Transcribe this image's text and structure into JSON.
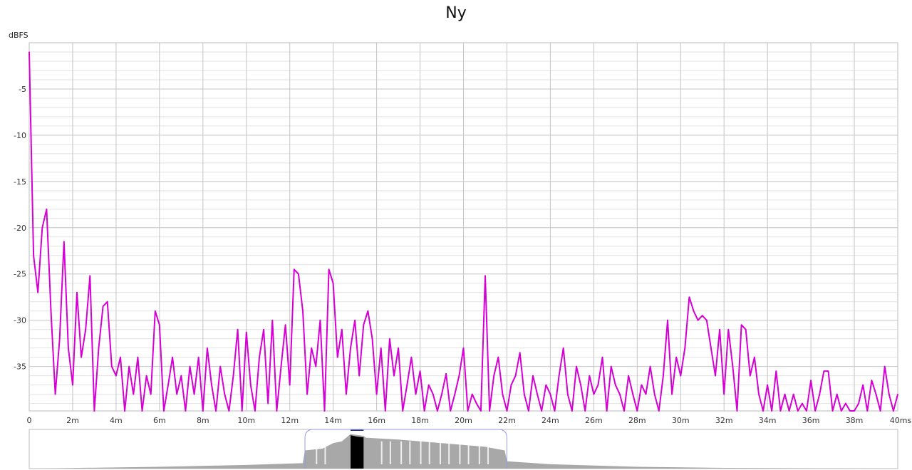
{
  "chart_data": {
    "type": "line",
    "title": "Ny",
    "ylabel": "dBFS",
    "xlabel": "",
    "xlim": [
      0,
      40
    ],
    "ylim": [
      -39.8,
      0
    ],
    "x_unit_suffix": "ms",
    "x_ticks": [
      "0",
      "2m",
      "4m",
      "6m",
      "8m",
      "10m",
      "12m",
      "14m",
      "16m",
      "18m",
      "20m",
      "22m",
      "24m",
      "26m",
      "28m",
      "30m",
      "32m",
      "34m",
      "36m",
      "38m",
      "40ms"
    ],
    "y_ticks": [
      "-5",
      "-10",
      "-15",
      "-20",
      "-25",
      "-30",
      "-35"
    ],
    "grid": true,
    "series": [
      {
        "name": "Ny",
        "color": "#d400d4",
        "x_start": 0,
        "x_step": 0.2,
        "values": [
          -1,
          -23,
          -27,
          -20,
          -18,
          -29,
          -38,
          -32,
          -21.5,
          -33,
          -37,
          -27,
          -34,
          -31,
          -25.2,
          -40,
          -33,
          -28.5,
          -28,
          -35,
          -36,
          -34,
          -40,
          -35,
          -38,
          -34,
          -40,
          -36,
          -38,
          -29,
          -30.5,
          -40,
          -37,
          -34,
          -38,
          -36,
          -40,
          -35,
          -38,
          -34,
          -40,
          -33,
          -37,
          -40,
          -35,
          -38,
          -40,
          -36,
          -31,
          -40,
          -31.3,
          -37,
          -40,
          -34,
          -31,
          -39,
          -30,
          -40,
          -35,
          -30.5,
          -37,
          -24.5,
          -25,
          -29,
          -38,
          -33,
          -35,
          -30,
          -40,
          -24.5,
          -26,
          -34,
          -31,
          -38,
          -33,
          -30,
          -36,
          -30.5,
          -29,
          -32,
          -38,
          -33,
          -40,
          -32,
          -36,
          -33,
          -40,
          -37,
          -34,
          -38,
          -35.5,
          -40,
          -37,
          -38,
          -40,
          -38,
          -35.8,
          -40,
          -38,
          -36,
          -33,
          -40,
          -38,
          -39,
          -40,
          -25.2,
          -40,
          -36,
          -34,
          -38,
          -40,
          -37,
          -36,
          -33.5,
          -38,
          -40,
          -36,
          -38,
          -40,
          -37,
          -38,
          -40,
          -36,
          -33,
          -38,
          -40,
          -35,
          -37,
          -40,
          -36,
          -38,
          -37,
          -34,
          -40,
          -35,
          -37,
          -38,
          -40,
          -36,
          -38,
          -40,
          -37,
          -38,
          -35,
          -38,
          -40,
          -36,
          -30,
          -38,
          -34,
          -36,
          -33,
          -27.5,
          -29,
          -30,
          -29.5,
          -30,
          -33,
          -36,
          -31,
          -38,
          -31,
          -35,
          -40,
          -30.5,
          -31,
          -36,
          -34,
          -38,
          -40,
          -37,
          -40,
          -35.5,
          -40,
          -38,
          -40,
          -38,
          -40,
          -39,
          -40,
          -36.5,
          -40,
          -38,
          -35.5,
          -35.5,
          -40,
          -38,
          -40,
          -39,
          -40,
          -40,
          -39,
          -37,
          -40,
          -36.5,
          -38,
          -40,
          -35,
          -38,
          -40,
          -38
        ]
      }
    ],
    "overview": {
      "envelope_x_ms": [
        0,
        6,
        10,
        12.6,
        12.7,
        13.5,
        14,
        14.4,
        14.8,
        15.4,
        15.5,
        17,
        19,
        21,
        21.9,
        22,
        24,
        28,
        32,
        40
      ],
      "envelope_level": [
        0.0,
        0.05,
        0.1,
        0.15,
        0.5,
        0.55,
        0.7,
        0.75,
        0.95,
        0.9,
        0.85,
        0.8,
        0.7,
        0.6,
        0.5,
        0.2,
        0.12,
        0.05,
        0.02,
        0.0
      ],
      "selection_ms": [
        14.8,
        15.4
      ],
      "window_ms": [
        12.7,
        22.0
      ]
    }
  }
}
